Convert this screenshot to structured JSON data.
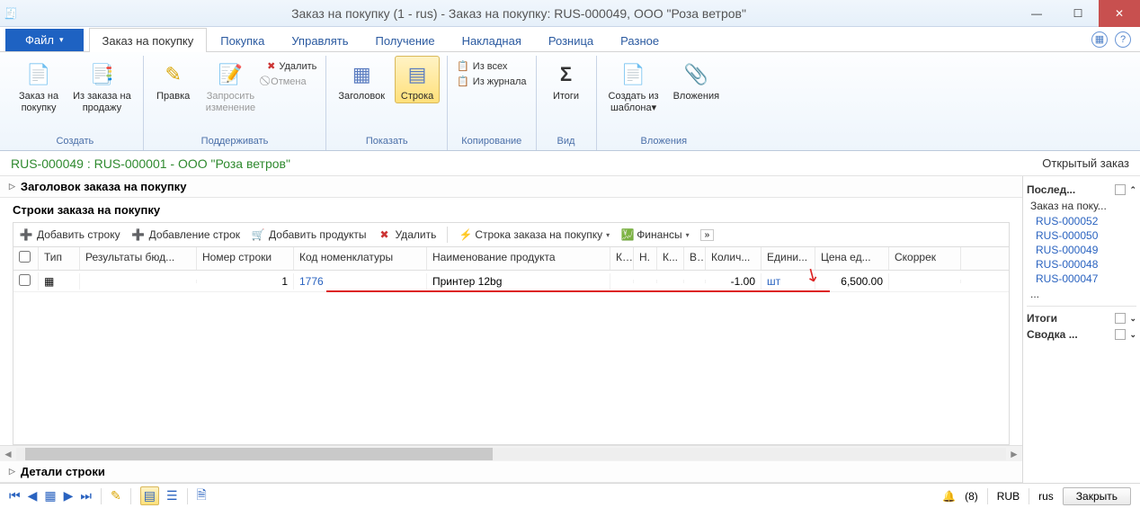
{
  "window": {
    "title": "Заказ на покупку (1 - rus) - Заказ на покупку: RUS-000049, ООО \"Роза ветров\""
  },
  "tabs": {
    "file": "Файл",
    "items": [
      "Заказ на покупку",
      "Покупка",
      "Управлять",
      "Получение",
      "Накладная",
      "Розница",
      "Разное"
    ],
    "activeIndex": 0
  },
  "ribbon": {
    "groups": [
      {
        "label": "Создать",
        "big": [
          {
            "name": "new-po",
            "lbl": "Заказ на\nпокупку",
            "ico": "📄"
          },
          {
            "name": "from-so",
            "lbl": "Из заказа на\nпродажу",
            "ico": "📑"
          }
        ]
      },
      {
        "label": "Поддерживать",
        "big": [
          {
            "name": "edit",
            "lbl": "Правка",
            "ico": "✎"
          },
          {
            "name": "request-change",
            "lbl": "Запросить\nизменение",
            "ico": "📝",
            "dis": true
          }
        ],
        "small": [
          {
            "name": "delete",
            "lbl": "Удалить",
            "ico": "✖"
          },
          {
            "name": "cancel",
            "lbl": "Отмена",
            "ico": "⃠",
            "dis": true
          }
        ]
      },
      {
        "label": "Показать",
        "big": [
          {
            "name": "header-view",
            "lbl": "Заголовок",
            "ico": "▦"
          },
          {
            "name": "line-view",
            "lbl": "Строка",
            "ico": "▤",
            "sel": true
          }
        ]
      },
      {
        "label": "Копирование",
        "small": [
          {
            "name": "from-all",
            "lbl": "Из всех",
            "ico": "📋"
          },
          {
            "name": "from-journal",
            "lbl": "Из журнала",
            "ico": "📋"
          }
        ]
      },
      {
        "label": "Вид",
        "big": [
          {
            "name": "totals",
            "lbl": "Итоги",
            "ico": "Σ"
          }
        ]
      },
      {
        "label": "Вложения",
        "big": [
          {
            "name": "from-template",
            "lbl": "Создать из\nшаблона▾",
            "ico": "📄"
          },
          {
            "name": "attachments",
            "lbl": "Вложения",
            "ico": "📎"
          }
        ]
      }
    ]
  },
  "info": {
    "left": "RUS-000049 : RUS-000001 - ООО \"Роза ветров\"",
    "right": "Открытый заказ"
  },
  "sections": {
    "header": "Заголовок заказа на покупку",
    "lines": "Строки заказа на покупку",
    "details": "Детали строки"
  },
  "linesToolbar": {
    "addLine": "Добавить строку",
    "addLines": "Добавление строк",
    "addProducts": "Добавить продукты",
    "delete": "Удалить",
    "poLine": "Строка заказа на покупку",
    "finance": "Финансы",
    "more": "»"
  },
  "grid": {
    "cols": [
      "",
      "Тип",
      "Результаты бюд...",
      "Номер строки",
      "Код номенклатуры",
      "Наименование продукта",
      "К...",
      "Н.",
      "К...",
      "В...",
      "Колич...",
      "Едини...",
      "Цена ед...",
      "Скоррек"
    ],
    "row": {
      "lineNo": "1",
      "item": "1776",
      "name": "Принтер 12bg",
      "qty": "-1.00",
      "unit": "шт",
      "price": "6,500.00"
    }
  },
  "side": {
    "recent": "Послед...",
    "recentTop": "Заказ на поку...",
    "recentItems": [
      "RUS-000052",
      "RUS-000050",
      "RUS-000049",
      "RUS-000048",
      "RUS-000047"
    ],
    "ellipsis": "...",
    "totals": "Итоги",
    "summary": "Сводка ..."
  },
  "status": {
    "notifications": "(8)",
    "currency": "RUB",
    "company": "rus",
    "close": "Закрыть"
  }
}
